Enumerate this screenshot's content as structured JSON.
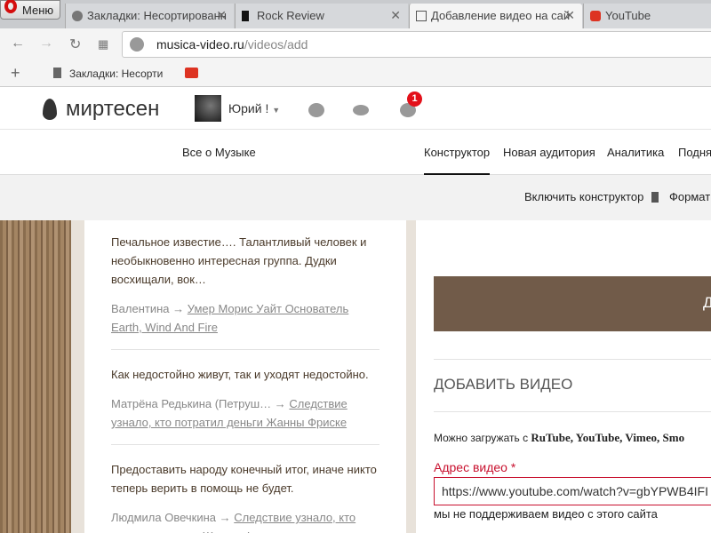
{
  "browser": {
    "menu_label": "Меню",
    "tabs": [
      {
        "title": "Закладки: Несортированн",
        "icon": "heart-icon"
      },
      {
        "title": "Rock Review",
        "icon": "rock-icon"
      },
      {
        "title": "Добавление видео на сай",
        "icon": "site-icon"
      },
      {
        "title": "YouTube",
        "icon": "youtube-icon"
      }
    ],
    "url_host": "musica-video.ru",
    "url_path": "/videos/add",
    "bookmarks": [
      {
        "title": "Закладки: Несортиро"
      }
    ]
  },
  "header": {
    "logo": "миртесен",
    "user": "Юрий !",
    "notifications": "1"
  },
  "subnav": {
    "site": "Все о Музыке",
    "items": [
      "Конструктор",
      "Новая аудитория",
      "Аналитика",
      "Подня"
    ]
  },
  "controls": {
    "enable": "Включить конструктор",
    "format": "Формат"
  },
  "comments": [
    {
      "text": "Печальное известие…. Талантливый человек и необыкновенно интересная группа. Дудки восхищали, вок…",
      "author": "Валентина",
      "link": "Умер Морис Уайт Основатель Earth, Wind And Fire"
    },
    {
      "text": "Как недостойно живут, так и уходят недостойно.",
      "author": "Матрёна Редькина (Петруш…",
      "link": "Следствие узнало, кто потратил деньги Жанны Фриске"
    },
    {
      "text": "Предоставить народу конечный итог, иначе никто теперь верить в помощь не будет.",
      "author": "Людмила Овечкина",
      "link": "Следствие узнало, кто потратил деньги Жанны Фриске"
    }
  ],
  "form": {
    "banner": "Д",
    "title": "ДОБАВИТЬ ВИДЕО",
    "note_prefix": "Можно загружать с ",
    "note_sources": "RuTube, YouTube, Vimeo, Smo",
    "label": "Адрес видео *",
    "value": "https://www.youtube.com/watch?v=gbYPWB4IFI",
    "error": "мы не поддерживаем видео с этого сайта"
  }
}
